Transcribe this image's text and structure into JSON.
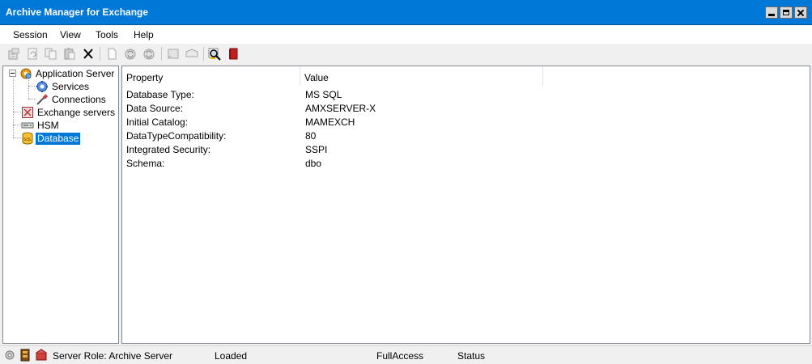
{
  "window": {
    "title": "Archive Manager for Exchange"
  },
  "menu": [
    {
      "label": "Session"
    },
    {
      "label": "View"
    },
    {
      "label": "Tools"
    },
    {
      "label": "Help"
    }
  ],
  "toolbar_icons": [
    "properties-icon",
    "refresh-icon",
    "copy-icon",
    "paste-icon",
    "delete-icon",
    "new-icon",
    "sync-icon",
    "sync-all-icon",
    "note-icon",
    "message-icon",
    "search-icon",
    "book-icon"
  ],
  "tree": {
    "application_server": "Application Server",
    "services": "Services",
    "connections": "Connections",
    "exchange_servers": "Exchange servers",
    "hsm": "HSM",
    "database": "Database",
    "selected": "Database"
  },
  "list": {
    "columns": [
      "Property",
      "Value"
    ],
    "rows": [
      [
        "Database Type:",
        "MS SQL"
      ],
      [
        "Data Source:",
        "AMXSERVER-X"
      ],
      [
        "Initial Catalog:",
        "MAMEXCH"
      ],
      [
        "DataTypeCompatibility:",
        "80"
      ],
      [
        "Integrated Security:",
        "SSPI"
      ],
      [
        "Schema:",
        "dbo"
      ]
    ]
  },
  "status": {
    "server_role": "Server Role: Archive Server",
    "loaded": "Loaded",
    "access": "FullAccess",
    "status": "Status"
  },
  "colors": {
    "titlebar": "#0078d7",
    "selection": "#0078d7"
  }
}
